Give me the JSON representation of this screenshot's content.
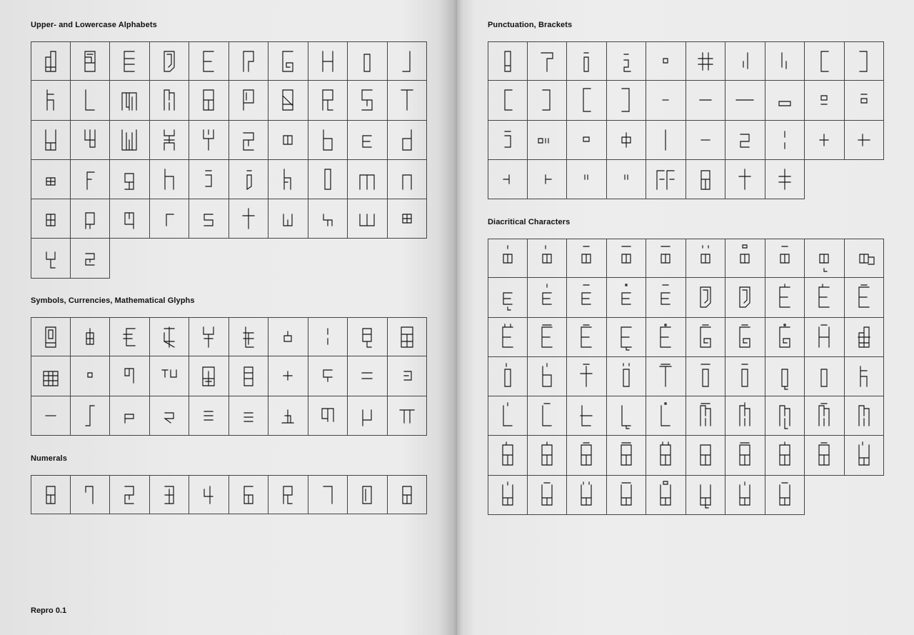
{
  "footer": {
    "label": "Repro 0.1"
  },
  "sections": [
    {
      "id": "alphabets",
      "title": "Upper- and Lowercase Alphabets",
      "cells": [
        "A",
        "B",
        "C",
        "D",
        "E",
        "F",
        "G",
        "H",
        "I",
        "J",
        "K",
        "L",
        "M",
        "N",
        "O",
        "P",
        "Q",
        "R",
        "S",
        "T",
        "U",
        "V",
        "W",
        "X",
        "Y",
        "Z",
        "a",
        "b",
        "c",
        "d",
        "e",
        "f",
        "g",
        "h",
        "i",
        "j",
        "k",
        "l",
        "m",
        "n",
        "o",
        "p",
        "q",
        "r",
        "s",
        "t",
        "u",
        "v",
        "w",
        "x",
        "y",
        "z"
      ]
    },
    {
      "id": "symbols",
      "title": "Symbols, Currencies, Mathematical Glyphs",
      "cells": [
        "@",
        "&",
        "€",
        "$",
        "¥",
        "£",
        "¢",
        "¦",
        "§",
        "#",
        "%",
        "°",
        "¶",
        "™",
        "‰",
        "¤",
        "+",
        "÷",
        "=",
        "≠",
        "−",
        "∫",
        "≤",
        "≥",
        "±",
        "∓",
        "∆",
        "Ω",
        "µ",
        "π"
      ]
    },
    {
      "id": "numerals",
      "title": "Numerals",
      "cells": [
        "8",
        "9",
        "2",
        "3",
        "4",
        "5",
        "6",
        "7",
        "0",
        "8b"
      ]
    },
    {
      "id": "punctuation",
      "title": "Punctuation, Brackets",
      "cells": [
        "!",
        "?",
        "¡",
        "¿",
        "·",
        "#p",
        "/",
        "\\",
        "[",
        "]",
        "(",
        ")",
        "{",
        "}",
        "-",
        "–",
        "—",
        "_",
        ":",
        ";",
        "i",
        "…",
        ".",
        "↔",
        "|",
        "ـ",
        "ž",
        "¦p",
        "‡",
        "†",
        "‹",
        "›",
        "‘",
        "“",
        "ﬀ",
        "&p",
        "t",
        "+p"
      ]
    },
    {
      "id": "diacritics",
      "title": "Diacritical Characters",
      "cells": [
        "á",
        "à",
        "â",
        "ã",
        "ā",
        "ä",
        "å",
        "ă",
        "ą",
        "æ",
        "ç",
        "ć",
        "ĉ",
        "ċ",
        "č",
        "ď",
        "đ",
        "é",
        "è",
        "ê",
        "ë",
        "ē",
        "ě",
        "ę",
        "ė",
        "ĝ",
        "ğ",
        "ġ",
        "ĥ",
        "ħ",
        "ì",
        "í",
        "î",
        "ï",
        "ĩ",
        "ī",
        "ĭ",
        "į",
        "ı",
        "ĵ",
        "ĺ",
        "ľ",
        "ł",
        "ļ",
        "ŀ",
        "ñ",
        "ń",
        "ņ",
        "ň",
        "ŉ",
        "ò",
        "ó",
        "ô",
        "õ",
        "ö",
        "ø",
        "ō",
        "ő",
        "ŏ",
        "ù",
        "ú",
        "û",
        "ü",
        "ū",
        "ů",
        "ų",
        "ű",
        "ŭ"
      ]
    }
  ]
}
